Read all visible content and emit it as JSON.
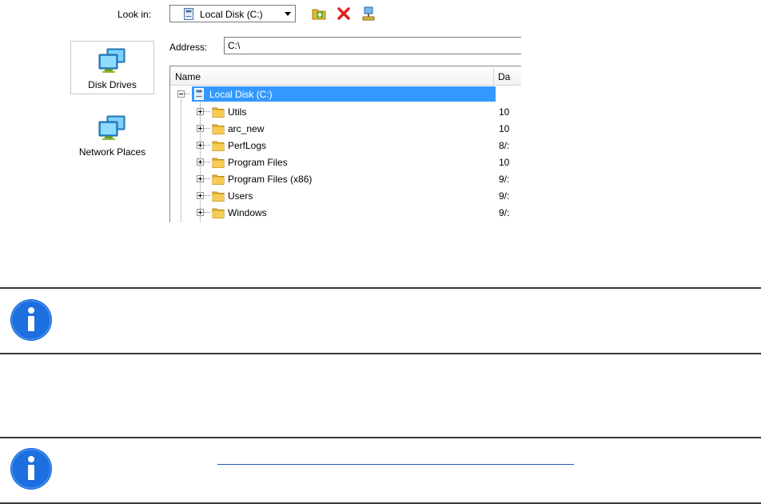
{
  "lookin": {
    "label": "Look in:",
    "selected": "Local Disk (C:)"
  },
  "toolbar": {
    "icons": [
      "new-folder-icon",
      "delete-icon",
      "network-drive-icon"
    ]
  },
  "places": [
    {
      "label": "Disk Drives",
      "icon": "disk-drives-icon"
    },
    {
      "label": "Network Places",
      "icon": "network-places-icon"
    }
  ],
  "address": {
    "label": "Address:",
    "value": "C:\\"
  },
  "tree": {
    "columns": [
      "Name",
      "Da"
    ],
    "root": {
      "name": "Local Disk (C:)"
    },
    "children": [
      {
        "name": "Utils",
        "date": "10"
      },
      {
        "name": "arc_new",
        "date": "10"
      },
      {
        "name": "PerfLogs",
        "date": "8/:"
      },
      {
        "name": "Program Files",
        "date": "10"
      },
      {
        "name": "Program Files (x86)",
        "date": "9/:"
      },
      {
        "name": "Users",
        "date": "9/:"
      },
      {
        "name": "Windows",
        "date": "9/:"
      }
    ]
  },
  "colors": {
    "selection": "#3399ff",
    "info_icon": "#1d6fe0",
    "link": "#2a5ab7"
  }
}
